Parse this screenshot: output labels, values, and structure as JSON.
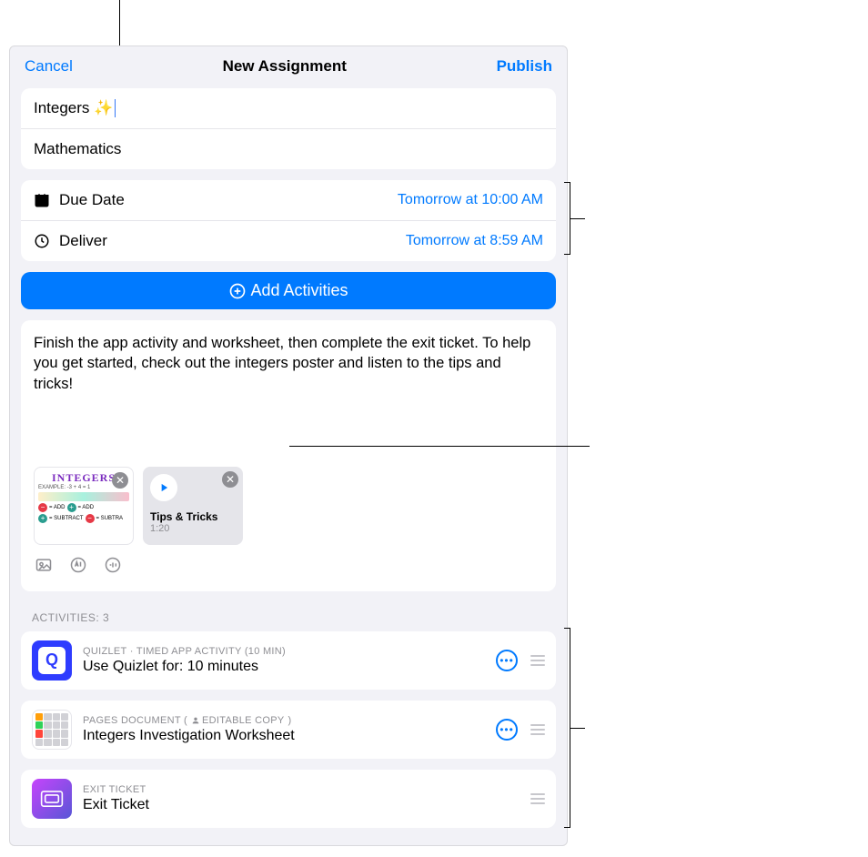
{
  "nav": {
    "cancel": "Cancel",
    "title": "New Assignment",
    "publish": "Publish"
  },
  "fields": {
    "name": "Integers ✨",
    "class": "Mathematics"
  },
  "schedule": {
    "dueLabel": "Due Date",
    "dueValue": "Tomorrow at 10:00 AM",
    "deliverLabel": "Deliver",
    "deliverValue": "Tomorrow at 8:59 AM"
  },
  "addActivities": "Add Activities",
  "instructions": "Finish the app activity and worksheet, then complete the exit ticket. To help you get started, check out the integers poster and listen to the tips and tricks!",
  "attachments": {
    "poster": {
      "title": "INTEGERS",
      "example": "EXAMPLE: -3 + 4 = 1",
      "ops": [
        "ADD",
        "ADD",
        "SUBTRACT",
        "SUBTRA"
      ]
    },
    "audio": {
      "title": "Tips & Tricks",
      "duration": "1:20"
    }
  },
  "activitiesLabel": "ACTIVITIES: 3",
  "activities": [
    {
      "meta": "QUIZLET · TIMED APP ACTIVITY (10 MIN)",
      "title": "Use Quizlet for: 10 minutes",
      "hasMore": true
    },
    {
      "metaPrefix": "PAGES DOCUMENT  (",
      "metaBadge": "EDITABLE COPY",
      "metaSuffix": ")",
      "title": "Integers Investigation Worksheet",
      "hasMore": true
    },
    {
      "meta": "EXIT TICKET",
      "title": "Exit Ticket",
      "hasMore": false
    }
  ]
}
